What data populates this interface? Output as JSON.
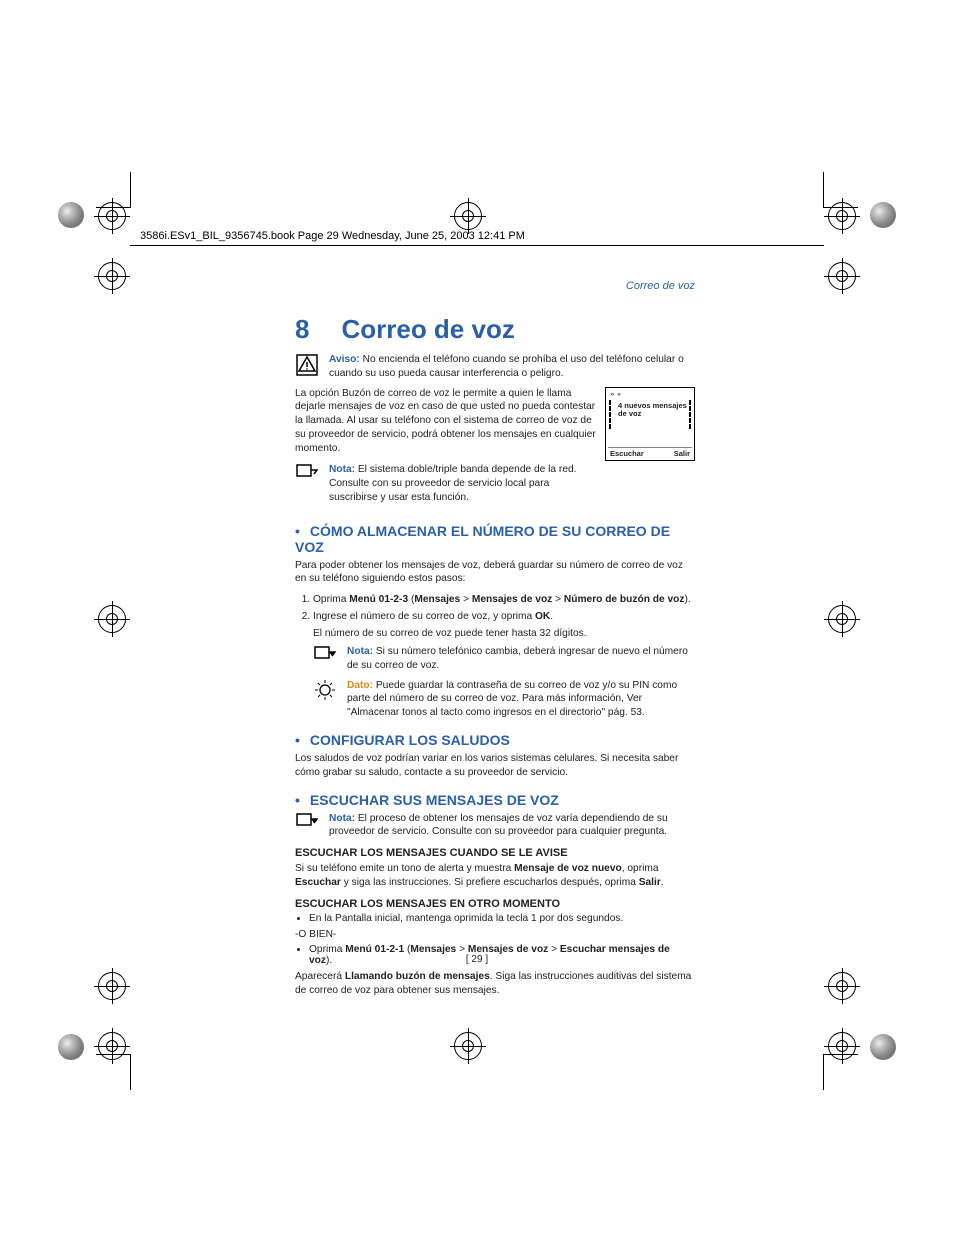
{
  "header_line": "3586i.ESv1_BIL_9356745.book  Page 29  Wednesday, June 25, 2003  12:41 PM",
  "running_head": "Correo de voz",
  "chapter": {
    "number": "8",
    "title": "Correo de voz"
  },
  "aviso": {
    "label": "Aviso:",
    "text": " No encienda el teléfono cuando se prohíba el uso del teléfono celular o cuando su uso pueda causar interferencia o peligro."
  },
  "intro": "La opción Buzón de correo de voz le permite a quien le llama dejarle mensajes de voz en caso de que usted no pueda contestar la llamada. Al usar su teléfono con el sistema de correo de voz de su proveedor de servicio, podrá obtener los mensajes en cualquier momento.",
  "nota1": {
    "label": "Nota:",
    "text": " El sistema doble/triple banda depende de la red. Consulte con su proveedor de servicio local para suscribirse y usar esta función."
  },
  "phone_screen": {
    "icon": "◇",
    "message_line1": "4 nuevos mensajes",
    "message_line2": "de voz",
    "left_soft": "Escuchar",
    "right_soft": "Salir"
  },
  "section1": {
    "title": "CÓMO ALMACENAR EL NÚMERO DE SU CORREO DE VOZ",
    "intro": "Para poder obtener los mensajes de voz, deberá guardar su número de correo de voz en su teléfono siguiendo estos pasos:",
    "step1_a": "Oprima ",
    "step1_menu": "Menú 01-2-3",
    "step1_b": " (",
    "step1_m1": "Mensajes",
    "step1_gt1": " > ",
    "step1_m2": "Mensajes de voz",
    "step1_gt2": " > ",
    "step1_m3": "Número de buzón de voz",
    "step1_c": ").",
    "step2_a": "Ingrese el número de su correo de voz, y oprima ",
    "step2_ok": "OK",
    "step2_b": ".",
    "step_sub": "El número de su correo de voz puede tener hasta 32 dígitos.",
    "nota2": {
      "label": "Nota:",
      "text": " Si su número telefónico cambia, deberá ingresar de nuevo el número de su correo de voz."
    },
    "dato": {
      "label": "Dato:",
      "text": " Puede guardar la contraseña de su correo de voz y/o su PIN como parte del número de su correo de voz. Para más información, Ver \"Almacenar tonos al tacto como ingresos en el directorio\" pág. 53."
    }
  },
  "section2": {
    "title": "CONFIGURAR LOS SALUDOS",
    "text": "Los saludos de voz podrían variar en los varios sistemas celulares. Si necesita saber cómo grabar su saludo, contacte a su proveedor de servicio."
  },
  "section3": {
    "title": "ESCUCHAR SUS MENSAJES DE VOZ",
    "nota": {
      "label": "Nota:",
      "text": " El proceso de obtener los mensajes de voz varía dependiendo de su proveedor de servicio. Consulte con su proveedor para cualquier pregunta."
    },
    "sub1_title": "ESCUCHAR LOS MENSAJES CUANDO SE LE AVISE",
    "sub1_a": "Si su teléfono emite un tono de alerta y muestra ",
    "sub1_b1": "Mensaje de voz nuevo",
    "sub1_c": ", oprima ",
    "sub1_b2": "Escuchar",
    "sub1_d": " y siga las instrucciones. Si prefiere escucharlos después, oprima ",
    "sub1_b3": "Salir",
    "sub1_e": ".",
    "sub2_title": "ESCUCHAR LOS MENSAJES EN OTRO MOMENTO",
    "sub2_bullet1": "En la Pantalla inicial, mantenga oprimida la tecla 1 por dos segundos.",
    "sub2_or": "-O BIEN-",
    "sub2_b2a": "Oprima ",
    "sub2_menu": "Menú 01-2-1",
    "sub2_b2b": " (",
    "sub2_m1": "Mensajes",
    "sub2_gt1": " > ",
    "sub2_m2": "Mensajes de voz",
    "sub2_gt2": " > ",
    "sub2_m3": "Escuchar mensajes de voz",
    "sub2_b2c": ").",
    "final_a": "Aparecerá ",
    "final_b": "Llamando buzón de mensajes",
    "final_c": ". Siga las instrucciones auditivas del sistema de correo de voz para obtener sus mensajes."
  },
  "page_number": "[ 29 ]"
}
